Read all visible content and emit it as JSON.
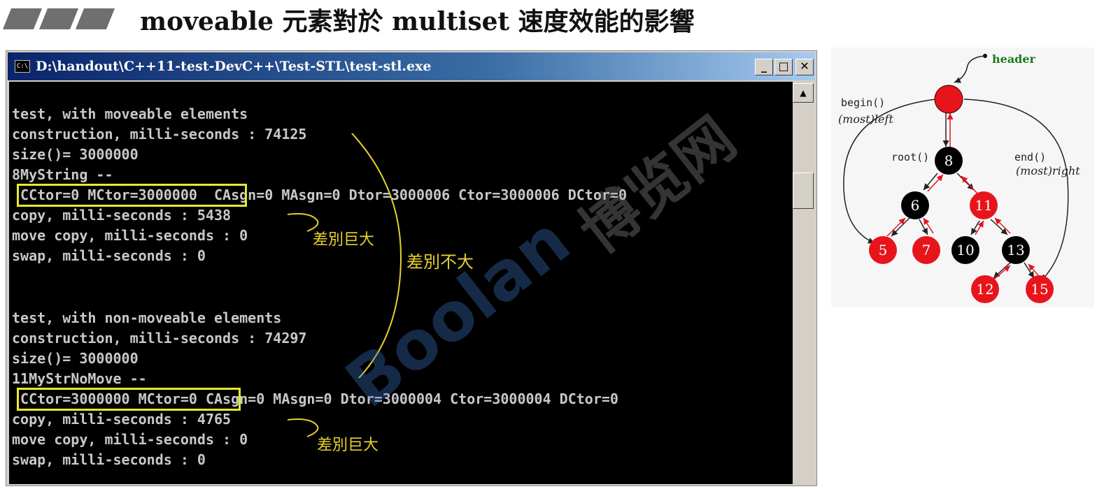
{
  "slide": {
    "title": "moveable 元素對於 multiset 速度效能的影響"
  },
  "window": {
    "icon_text": "C:\\",
    "title": "D:\\handout\\C++11-test-DevC++\\Test-STL\\test-stl.exe",
    "controls": {
      "minimize": "_",
      "maximize": "□",
      "close": "✕"
    },
    "scroll_up": "▲"
  },
  "console": {
    "lines": [
      "test, with moveable elements",
      "construction, milli-seconds : 74125",
      "size()= 3000000",
      "8MyString --",
      " CCtor=0 MCtor=3000000  CAsgn=0 MAsgn=0 Dtor=3000006 Ctor=3000006 DCtor=0",
      "copy, milli-seconds : 5438",
      "move copy, milli-seconds : 0",
      "swap, milli-seconds : 0",
      "",
      "",
      "test, with non-moveable elements",
      "construction, milli-seconds : 74297",
      "size()= 3000000",
      "11MyStrNoMove --",
      " CCtor=3000000 MCtor=0 CAsgn=0 MAsgn=0 Dtor=3000004 Ctor=3000004 DCtor=0",
      "copy, milli-seconds : 4765",
      "move copy, milli-seconds : 0",
      "swap, milli-seconds : 0"
    ]
  },
  "annotations": {
    "big_diff_1": "差別巨大",
    "small_diff": "差別不大",
    "big_diff_2": "差別巨大"
  },
  "tree": {
    "header": "header",
    "begin": "begin()",
    "begin_sub": "(most)left",
    "root": "root()",
    "end": "end()",
    "end_sub": "(most)right",
    "nodes": [
      "8",
      "6",
      "11",
      "5",
      "7",
      "10",
      "13",
      "12",
      "15"
    ],
    "node_colors": {
      "red": "#e8141c",
      "black": "#000000"
    }
  },
  "watermark": {
    "main": "Boolan",
    "secondary": "博览网"
  }
}
